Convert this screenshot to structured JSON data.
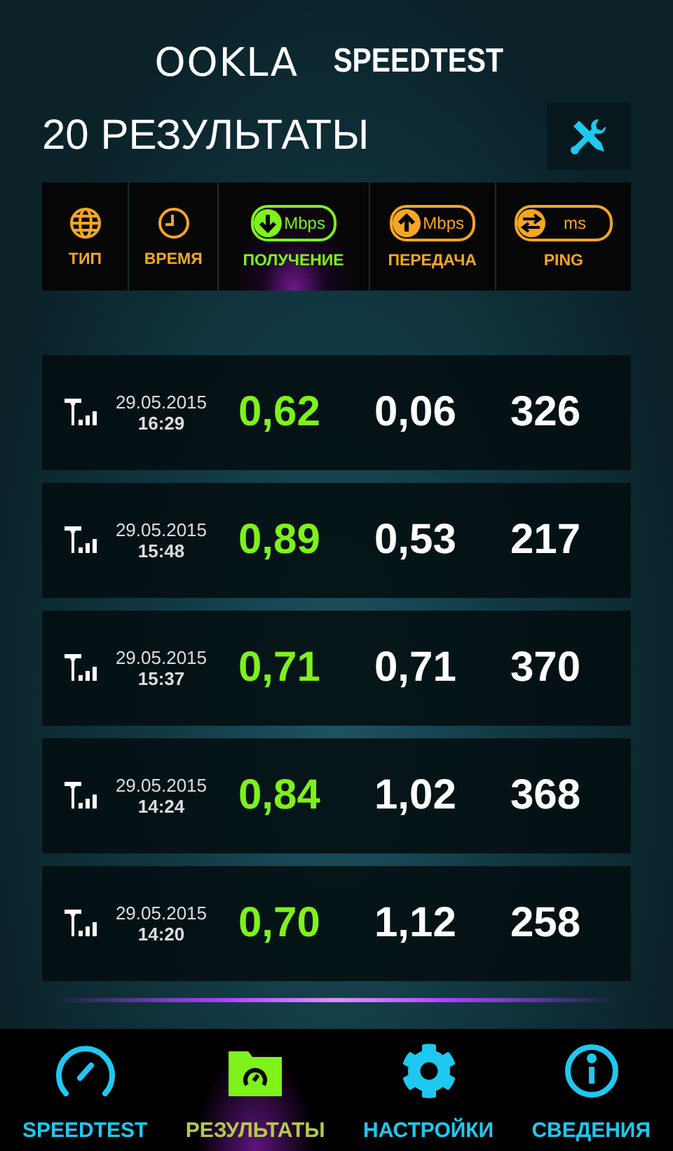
{
  "logo": {
    "brand": "OOKLA",
    "product": "SPEEDTEST"
  },
  "title": "20 РЕЗУЛЬТАТЫ",
  "columns": [
    {
      "kind": "type",
      "label": "ТИП",
      "selected": false
    },
    {
      "kind": "time",
      "label": "ВРЕМЯ",
      "selected": false
    },
    {
      "kind": "download",
      "label": "ПОЛУЧЕНИЕ",
      "unit": "Mbps",
      "selected": true
    },
    {
      "kind": "upload",
      "label": "ПЕРЕДАЧА",
      "unit": "Mbps",
      "selected": false
    },
    {
      "kind": "ping",
      "label": "PING",
      "unit": "ms",
      "selected": false
    }
  ],
  "results": [
    {
      "date": "29.05.2015",
      "time": "16:29",
      "download": "0,62",
      "upload": "0,06",
      "ping": "326"
    },
    {
      "date": "29.05.2015",
      "time": "15:48",
      "download": "0,89",
      "upload": "0,53",
      "ping": "217"
    },
    {
      "date": "29.05.2015",
      "time": "15:37",
      "download": "0,71",
      "upload": "0,71",
      "ping": "370"
    },
    {
      "date": "29.05.2015",
      "time": "14:24",
      "download": "0,84",
      "upload": "1,02",
      "ping": "368"
    },
    {
      "date": "29.05.2015",
      "time": "14:20",
      "download": "0,70",
      "upload": "1,12",
      "ping": "258"
    }
  ],
  "nav": [
    {
      "kind": "speedtest",
      "label": "SPEEDTEST",
      "selected": false
    },
    {
      "kind": "results",
      "label": "РЕЗУЛЬТАТЫ",
      "selected": true
    },
    {
      "kind": "settings",
      "label": "НАСТРОЙКИ",
      "selected": false
    },
    {
      "kind": "about",
      "label": "СВЕДЕНИЯ",
      "selected": false
    }
  ]
}
